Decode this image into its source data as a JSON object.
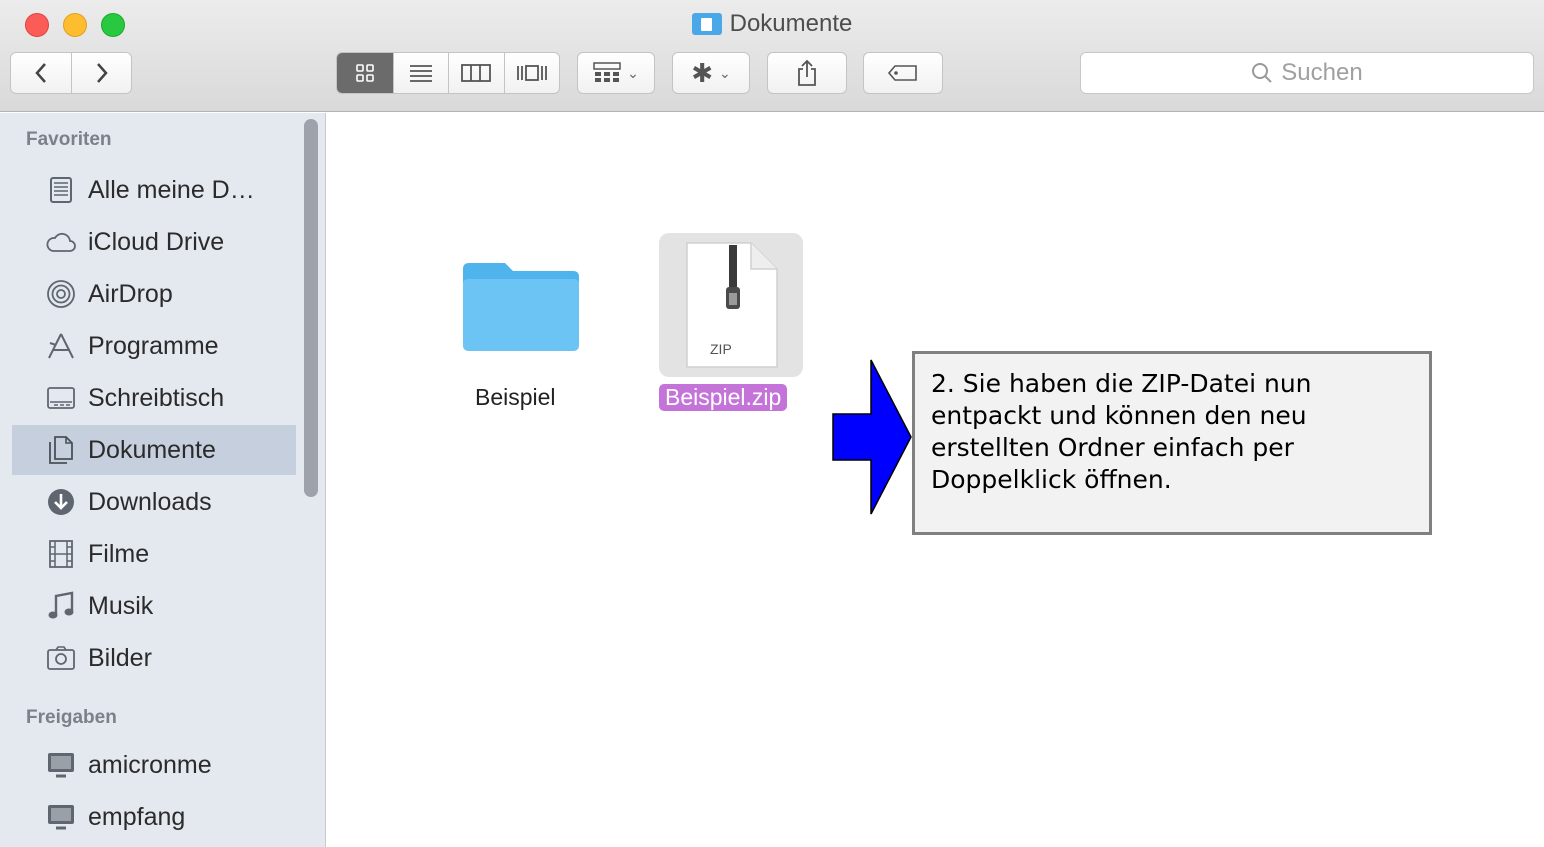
{
  "window": {
    "title": "Dokumente"
  },
  "toolbar": {
    "back_icon": "chevron-left",
    "forward_icon": "chevron-right",
    "view_modes": [
      "icon-view",
      "list-view",
      "column-view",
      "cover-flow-view"
    ],
    "active_view": "icon-view",
    "search_placeholder": "Suchen"
  },
  "sidebar": {
    "favorites_heading": "Favoriten",
    "favorites": [
      {
        "label": "Alle meine D…",
        "icon": "all-files-icon"
      },
      {
        "label": "iCloud Drive",
        "icon": "cloud-icon"
      },
      {
        "label": "AirDrop",
        "icon": "airdrop-icon"
      },
      {
        "label": "Programme",
        "icon": "applications-icon"
      },
      {
        "label": "Schreibtisch",
        "icon": "desktop-icon"
      },
      {
        "label": "Dokumente",
        "icon": "documents-icon",
        "selected": true
      },
      {
        "label": "Downloads",
        "icon": "downloads-icon"
      },
      {
        "label": "Filme",
        "icon": "movies-icon"
      },
      {
        "label": "Musik",
        "icon": "music-icon"
      },
      {
        "label": "Bilder",
        "icon": "pictures-icon"
      }
    ],
    "shared_heading": "Freigaben",
    "shared": [
      {
        "label": "amicronme",
        "icon": "computer-icon"
      },
      {
        "label": "empfang",
        "icon": "computer-icon"
      }
    ]
  },
  "files": [
    {
      "name": "Beispiel",
      "type": "folder"
    },
    {
      "name": "Beispiel.zip",
      "type": "zip",
      "badge": "ZIP",
      "selected": true
    }
  ],
  "annotation": {
    "lines": [
      "2. Sie haben die ZIP-Datei nun",
      "entpackt und können den neu",
      "erstellten Ordner einfach per",
      "Doppelklick öffnen."
    ],
    "arrow_color": "#0000ff"
  },
  "colors": {
    "selection_label": "#c474d9",
    "sidebar_selection": "#c5cfdd",
    "folder_blue": "#6cc4f5"
  }
}
